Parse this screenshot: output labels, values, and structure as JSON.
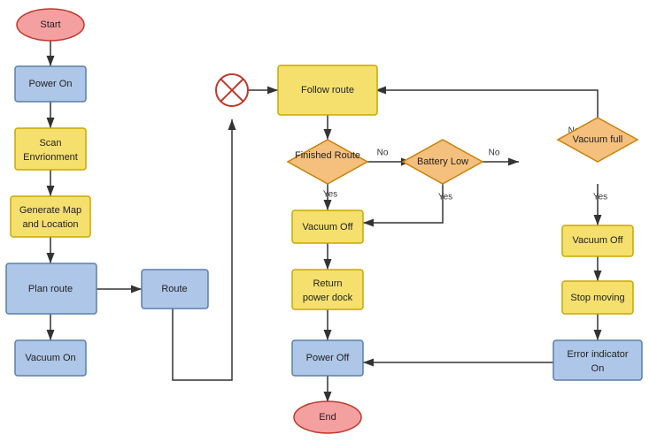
{
  "nodes": {
    "start": {
      "label": "Start"
    },
    "power_on": {
      "label": "Power On"
    },
    "scan": {
      "label": "Scan\nEnvrionment"
    },
    "generate_map": {
      "label": "Generate Map\nand Location"
    },
    "plan_route": {
      "label": "Plan route"
    },
    "vacuum_on": {
      "label": "Vacuum On"
    },
    "route": {
      "label": "Route"
    },
    "loop_node": {
      "label": "⊗"
    },
    "follow_route": {
      "label": "Follow route"
    },
    "finished_route": {
      "label": "Finished Route"
    },
    "battery_low": {
      "label": "Battery Low"
    },
    "vacuum_full": {
      "label": "Vacuum full"
    },
    "vacuum_off_left": {
      "label": "Vacuum Off"
    },
    "return_power": {
      "label": "Return\npower dock"
    },
    "power_off": {
      "label": "Power Off"
    },
    "end": {
      "label": "End"
    },
    "vacuum_off_right": {
      "label": "Vacuum Off"
    },
    "stop_moving": {
      "label": "Stop moving"
    },
    "error_indicator": {
      "label": "Error indicator\nOn"
    }
  }
}
